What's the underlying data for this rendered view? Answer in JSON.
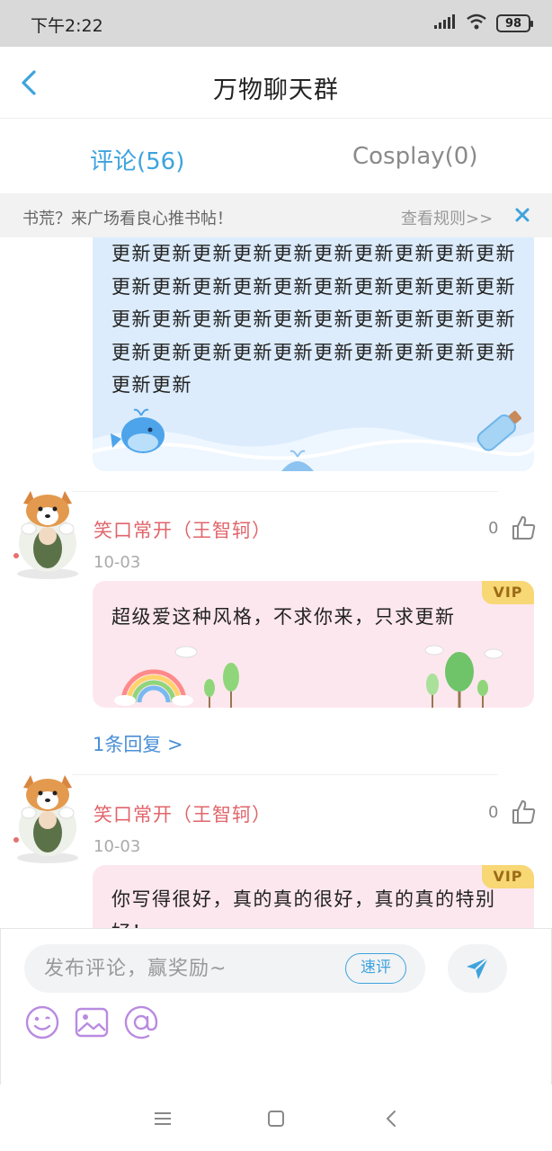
{
  "status_bar": {
    "time": "下午2:22",
    "battery": "98"
  },
  "header": {
    "title": "万物聊天群"
  },
  "tabs": [
    {
      "label": "评论(56)",
      "active": true
    },
    {
      "label": "Cosplay(0)",
      "active": false
    }
  ],
  "notice": {
    "text": "书荒？来广场看良心推书帖！",
    "rules_link": "查看规则>>"
  },
  "comments": [
    {
      "text": "更新更新更新更新更新更新更新更新更新更新更新更新更新更新更新更新更新更新更新更新更新更新更新更新更新更新更新更新更新更新更新更新更新更新更新更新更新更新更新更新更新更新"
    },
    {
      "username": "笑口常开（王智轲）",
      "date": "10-03",
      "likes": "0",
      "vip": "VIP",
      "text": "超级爱这种风格，不求你来，只求更新",
      "replies": "1条回复 >"
    },
    {
      "username": "笑口常开（王智轲）",
      "date": "10-03",
      "likes": "0",
      "vip": "VIP",
      "text": "你写得很好，真的真的很好，真的真的特别好！"
    }
  ],
  "composer": {
    "placeholder": "发布评论，赢奖励~",
    "quick_review": "速评",
    "tools": [
      "emoji-icon",
      "image-icon",
      "mention-icon"
    ]
  },
  "colors": {
    "accent": "#3ea3dd",
    "username": "#e0656b",
    "tool_icons": "#b98be0",
    "vip_bg": "#f8d775"
  }
}
